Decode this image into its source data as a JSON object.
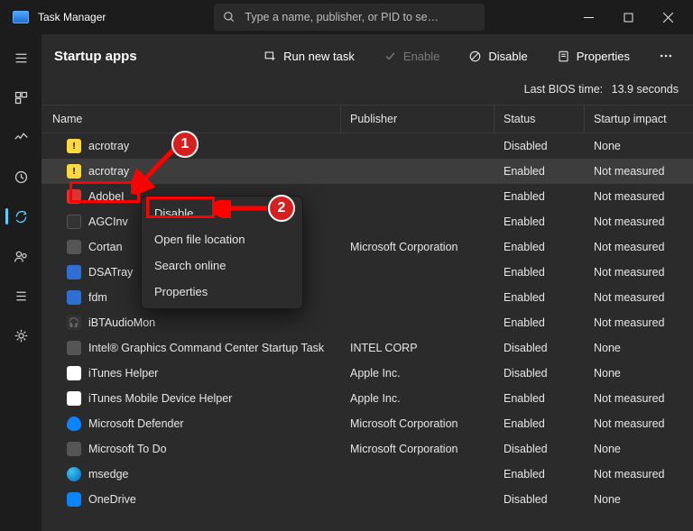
{
  "titlebar": {
    "title": "Task Manager"
  },
  "search": {
    "placeholder": "Type a name, publisher, or PID to se…"
  },
  "toolbar": {
    "heading": "Startup apps",
    "run_new_task": "Run new task",
    "enable": "Enable",
    "disable": "Disable",
    "properties": "Properties"
  },
  "bios": {
    "label": "Last BIOS time:",
    "value": "13.9 seconds"
  },
  "columns": {
    "name": "Name",
    "publisher": "Publisher",
    "status": "Status",
    "impact": "Startup impact"
  },
  "rows": [
    {
      "name": "acrotray",
      "icon": "warn",
      "publisher": "",
      "status": "Disabled",
      "impact": "None",
      "selected": false
    },
    {
      "name": "acrotray",
      "icon": "warn",
      "publisher": "",
      "status": "Enabled",
      "impact": "Not measured",
      "selected": true
    },
    {
      "name": "AdobeI",
      "icon": "red",
      "publisher": "",
      "status": "Enabled",
      "impact": "Not measured",
      "selected": false
    },
    {
      "name": "AGCInv",
      "icon": "dk",
      "publisher": "",
      "status": "Enabled",
      "impact": "Not measured",
      "selected": false
    },
    {
      "name": "Cortan",
      "icon": "generic",
      "publisher": "Microsoft Corporation",
      "status": "Enabled",
      "impact": "Not measured",
      "selected": false
    },
    {
      "name": "DSATray",
      "icon": "blue",
      "publisher": "",
      "status": "Enabled",
      "impact": "Not measured",
      "selected": false
    },
    {
      "name": "fdm",
      "icon": "blue",
      "publisher": "",
      "status": "Enabled",
      "impact": "Not measured",
      "selected": false
    },
    {
      "name": "iBTAudioMon",
      "icon": "head",
      "publisher": "",
      "status": "Enabled",
      "impact": "Not measured",
      "selected": false
    },
    {
      "name": "Intel® Graphics Command Center Startup Task",
      "icon": "generic",
      "publisher": "INTEL CORP",
      "status": "Disabled",
      "impact": "None",
      "selected": false
    },
    {
      "name": "iTunes Helper",
      "icon": "apple",
      "publisher": "Apple Inc.",
      "status": "Disabled",
      "impact": "None",
      "selected": false
    },
    {
      "name": "iTunes Mobile Device Helper",
      "icon": "apple",
      "publisher": "Apple Inc.",
      "status": "Enabled",
      "impact": "Not measured",
      "selected": false
    },
    {
      "name": "Microsoft Defender",
      "icon": "shield",
      "publisher": "Microsoft Corporation",
      "status": "Enabled",
      "impact": "Not measured",
      "selected": false
    },
    {
      "name": "Microsoft To Do",
      "icon": "generic",
      "publisher": "Microsoft Corporation",
      "status": "Disabled",
      "impact": "None",
      "selected": false
    },
    {
      "name": "msedge",
      "icon": "edge",
      "publisher": "",
      "status": "Enabled",
      "impact": "Not measured",
      "selected": false
    },
    {
      "name": "OneDrive",
      "icon": "cloud",
      "publisher": "",
      "status": "Disabled",
      "impact": "None",
      "selected": false
    }
  ],
  "ctxmenu": [
    "Disable",
    "Open file location",
    "Search online",
    "Properties"
  ],
  "annotations": {
    "badge1": "1",
    "badge2": "2"
  }
}
